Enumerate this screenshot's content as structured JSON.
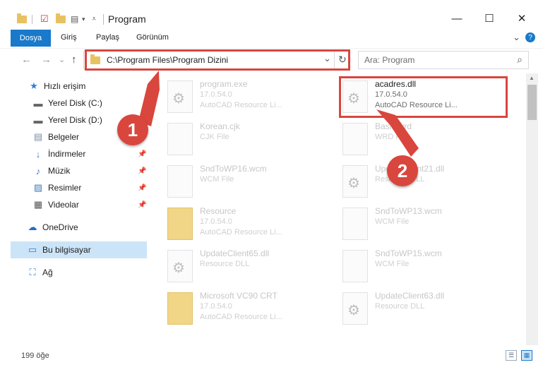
{
  "window": {
    "title": "Program",
    "minimize": "—",
    "maximize": "☐",
    "close": "✕"
  },
  "ribbon": {
    "tabs": [
      "Dosya",
      "Giriş",
      "Paylaş",
      "Görünüm"
    ],
    "collapse": "⌄",
    "help": "?"
  },
  "nav": {
    "back": "←",
    "forward": "→",
    "recent": "⌄",
    "up": "↑"
  },
  "address": {
    "path": "C:\\Program Files\\Program Dizini",
    "dropdown": "⌄",
    "refresh": "↻"
  },
  "search": {
    "placeholder": "Ara: Program",
    "icon": "⌕"
  },
  "sidebar": {
    "items": [
      {
        "label": "Hızlı erişim",
        "icon": "★"
      },
      {
        "label": "Yerel Disk (C:)",
        "icon": "▬"
      },
      {
        "label": "Yerel Disk (D:)",
        "icon": "▬"
      },
      {
        "label": "Belgeler",
        "icon": "▤"
      },
      {
        "label": "İndirmeler",
        "icon": "↓"
      },
      {
        "label": "Müzik",
        "icon": "♪"
      },
      {
        "label": "Resimler",
        "icon": "▨"
      },
      {
        "label": "Videolar",
        "icon": "▦"
      },
      {
        "label": "OneDrive",
        "icon": "☁"
      },
      {
        "label": "Bu bilgisayar",
        "icon": "▭"
      },
      {
        "label": "Ağ",
        "icon": "⛶"
      }
    ],
    "pin": "📌"
  },
  "files": [
    {
      "name": "program.exe",
      "l2": "17.0.54.0",
      "l3": "AutoCAD Resource Li...",
      "kind": "gear"
    },
    {
      "name": "acadres.dll",
      "l2": "17.0.54.0",
      "l3": "AutoCAD Resource Li...",
      "kind": "gear"
    },
    {
      "name": "Korean.cjk",
      "l2": "CJK File",
      "l3": "",
      "kind": "doc"
    },
    {
      "name": "Basic.wrd",
      "l2": "WRD File",
      "l3": "",
      "kind": "doc"
    },
    {
      "name": "SndToWP16.wcm",
      "l2": "WCM File",
      "l3": "",
      "kind": "doc"
    },
    {
      "name": "UpdateClient21.dll",
      "l2": "Resource DLL",
      "l3": "",
      "kind": "gear"
    },
    {
      "name": "Resource",
      "l2": "17.0.54.0",
      "l3": "AutoCAD Resource Li...",
      "kind": "fold"
    },
    {
      "name": "SndToWP13.wcm",
      "l2": "WCM File",
      "l3": "",
      "kind": "doc"
    },
    {
      "name": "UpdateClient65.dll",
      "l2": "Resource DLL",
      "l3": "",
      "kind": "gear"
    },
    {
      "name": "SndToWP15.wcm",
      "l2": "WCM File",
      "l3": "",
      "kind": "doc"
    },
    {
      "name": "Microsoft VC90 CRT",
      "l2": "17.0.54.0",
      "l3": "AutoCAD Resource Li...",
      "kind": "fold"
    },
    {
      "name": "UpdateClient63.dll",
      "l2": "Resource DLL",
      "l3": "",
      "kind": "gear"
    }
  ],
  "annotations": {
    "step1": "1",
    "step2": "2"
  },
  "status": {
    "count": "199 öğe"
  }
}
